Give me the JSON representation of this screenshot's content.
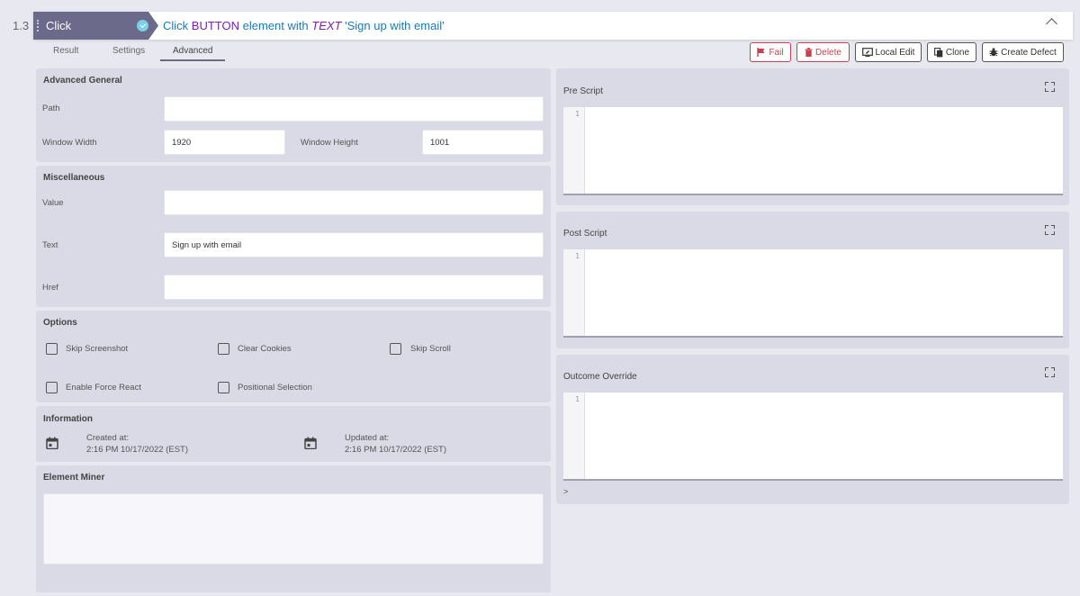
{
  "step": {
    "number": "1.3",
    "action": "Click",
    "desc_prefix": "Click",
    "desc_element": "BUTTON",
    "desc_middle": "element with",
    "desc_selector": "TEXT",
    "desc_value": "'Sign up with email'"
  },
  "tabs": [
    {
      "label": "Result",
      "active": false
    },
    {
      "label": "Settings",
      "active": false
    },
    {
      "label": "Advanced",
      "active": true
    }
  ],
  "buttons": {
    "fail": "Fail",
    "delete": "Delete",
    "local_edit": "Local Edit",
    "clone": "Clone",
    "create_defect": "Create Defect"
  },
  "advanced_general": {
    "title": "Advanced General",
    "path_label": "Path",
    "path_value": "",
    "window_width_label": "Window Width",
    "window_width_value": "1920",
    "window_height_label": "Window Height",
    "window_height_value": "1001"
  },
  "miscellaneous": {
    "title": "Miscellaneous",
    "value_label": "Value",
    "value_value": "",
    "text_label": "Text",
    "text_value": "Sign up with email",
    "href_label": "Href",
    "href_value": ""
  },
  "options": {
    "title": "Options",
    "items": [
      {
        "label": "Skip Screenshot",
        "checked": false
      },
      {
        "label": "Clear Cookies",
        "checked": false
      },
      {
        "label": "Skip Scroll",
        "checked": false
      },
      {
        "label": "Enable Force React",
        "checked": false
      },
      {
        "label": "Positional Selection",
        "checked": false
      }
    ]
  },
  "information": {
    "title": "Information",
    "created_label": "Created at:",
    "created_value": "2:16 PM 10/17/2022 (EST)",
    "updated_label": "Updated at:",
    "updated_value": "2:16 PM 10/17/2022 (EST)"
  },
  "element_miner": {
    "title": "Element Miner"
  },
  "scripts": {
    "pre_title": "Pre Script",
    "post_title": "Post Script",
    "outcome_title": "Outcome Override",
    "line_number": "1",
    "outcome_toggle": ">"
  },
  "colors": {
    "action_tag": "#6c6a8a",
    "desc_text": "#1b7ab0",
    "keyword": "#7a1fa2",
    "danger": "#c8404f",
    "panel_bg": "#d9dae6",
    "page_bg": "#e7e8f0"
  }
}
